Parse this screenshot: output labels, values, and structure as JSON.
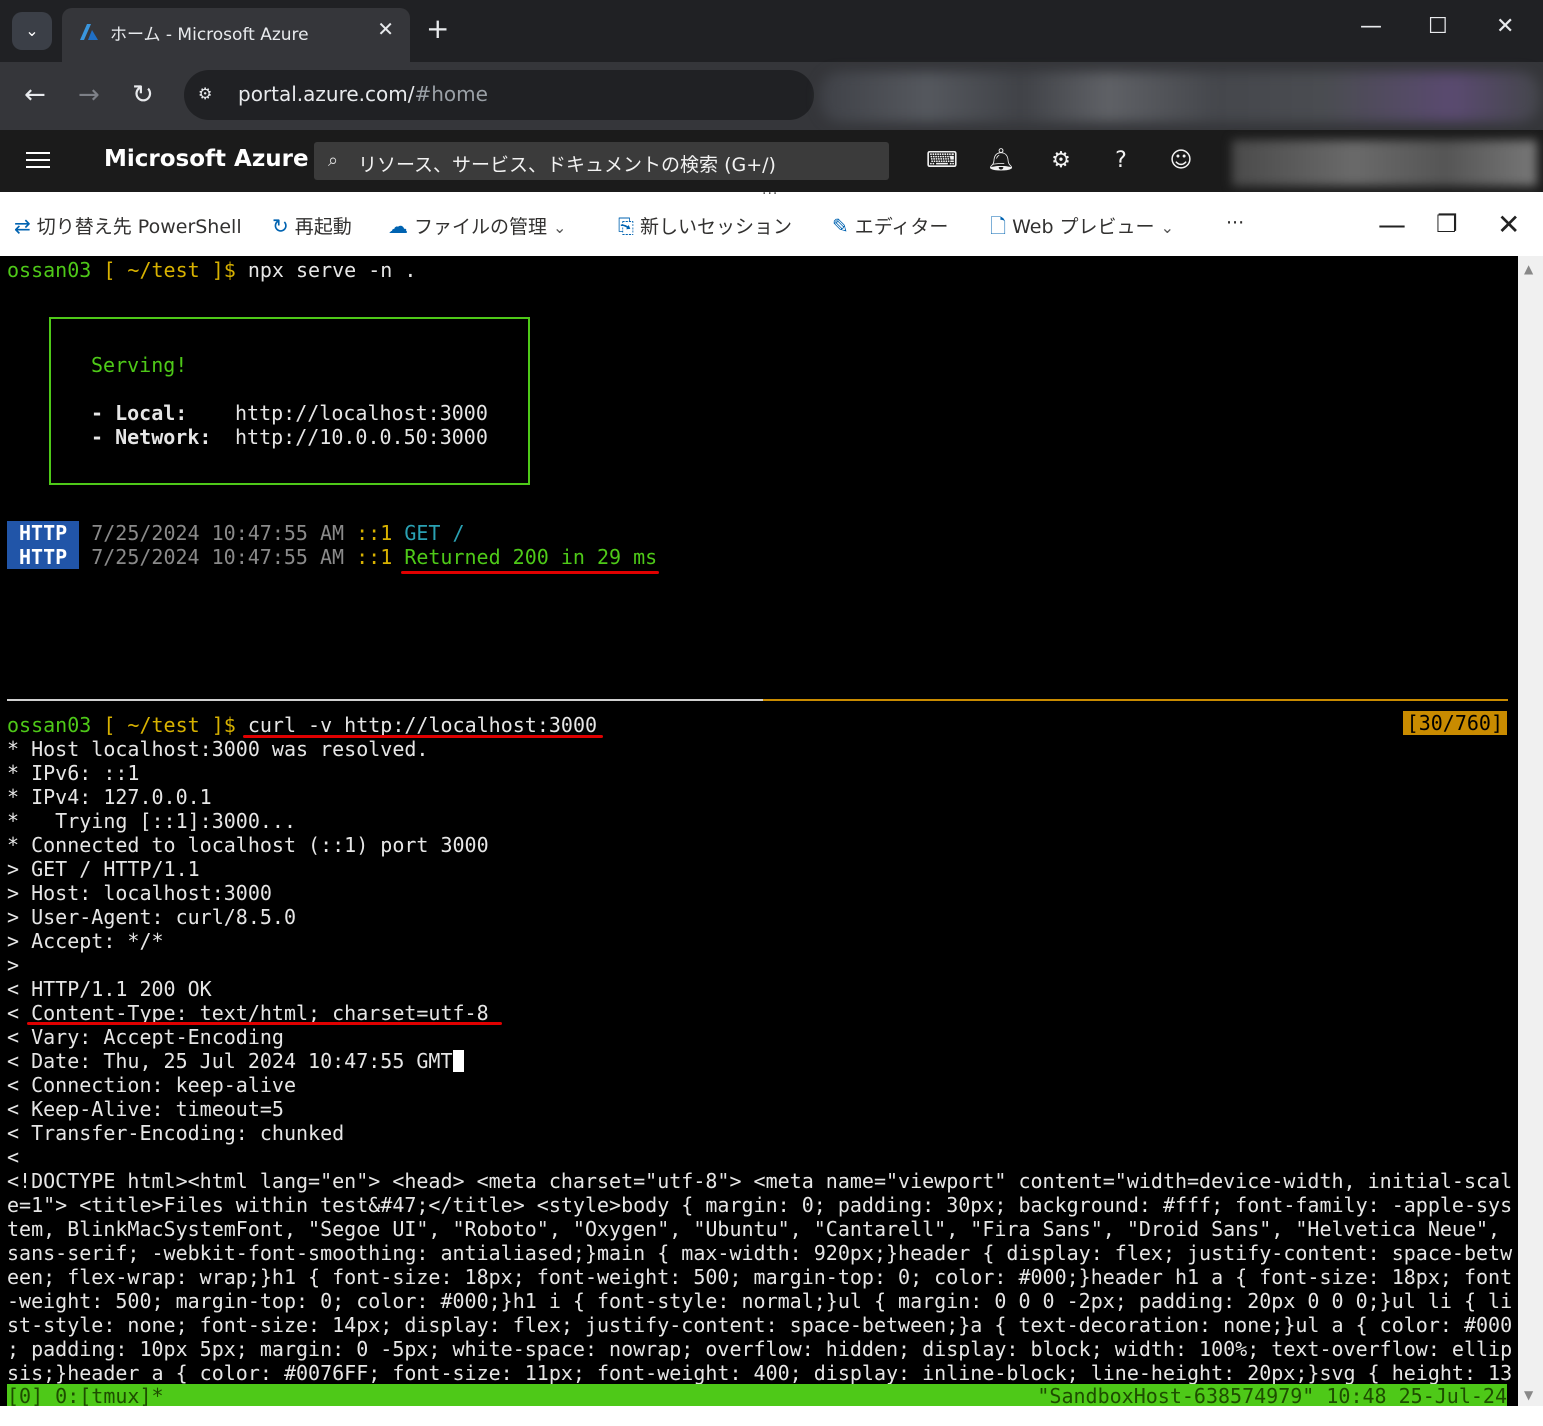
{
  "browser": {
    "tab_title": "ホーム - Microsoft Azure",
    "tab_close": "✕",
    "new_tab": "+",
    "tab_menu_icon": "chevron-down-icon",
    "window_controls": {
      "minimize": "—",
      "maximize": "☐",
      "close": "✕"
    },
    "url_host": "portal.azure.com/",
    "url_path": "#home"
  },
  "azure": {
    "brand": "Microsoft Azure",
    "search_placeholder": "リソース、サービス、ドキュメントの検索 (G+/)",
    "header_icons": [
      "cloud-shell-icon",
      "bell-icon",
      "gear-icon",
      "help-icon",
      "feedback-icon"
    ]
  },
  "cloudshell": {
    "switch_label": "切り替え先 PowerShell",
    "restart_label": "再起動",
    "files_label": "ファイルの管理",
    "new_session_label": "新しいセッション",
    "editor_label": "エディター",
    "web_preview_label": "Web プレビュー",
    "more_label": "···"
  },
  "terminal": {
    "prompt1": {
      "user": "ossan03",
      "dir": " [ ~/test ]$",
      "cmd": " npx serve -n ."
    },
    "serving": {
      "title": "Serving!",
      "local_label": "- Local:",
      "local_url": "http://localhost:3000",
      "network_label": "- Network:",
      "network_url": "http://10.0.0.50:3000"
    },
    "log": [
      {
        "tag": "HTTP",
        "time": "7/25/2024 10:47:55 AM",
        "addr": "::1",
        "msg": "GET /"
      },
      {
        "tag": "HTTP",
        "time": "7/25/2024 10:47:55 AM",
        "addr": "::1",
        "msg": "Returned 200 in 29 ms"
      }
    ],
    "prompt2": {
      "user": "ossan03",
      "dir": " [ ~/test ]$",
      "cmd": " curl -v http://localhost:3000"
    },
    "position": "[30/760]",
    "curl_lines": [
      "* Host localhost:3000 was resolved.",
      "* IPv6: ::1",
      "* IPv4: 127.0.0.1",
      "*   Trying [::1]:3000...",
      "* Connected to localhost (::1) port 3000",
      "> GET / HTTP/1.1",
      "> Host: localhost:3000",
      "> User-Agent: curl/8.5.0",
      "> Accept: */*",
      ">",
      "< HTTP/1.1 200 OK",
      "< Content-Type: text/html; charset=utf-8",
      "< Vary: Accept-Encoding",
      "< Date: Thu, 25 Jul 2024 10:47:55 GMT",
      "< Connection: keep-alive",
      "< Keep-Alive: timeout=5",
      "< Transfer-Encoding: chunked",
      "<",
      "<!DOCTYPE html><html lang=\"en\"> <head> <meta charset=\"utf-8\"> <meta name=\"viewport\" content=\"width=device-width, initial-scal",
      "e=1\"> <title>Files within test&#47;</title> <style>body { margin: 0; padding: 30px; background: #fff; font-family: -apple-sys",
      "tem, BlinkMacSystemFont, \"Segoe UI\", \"Roboto\", \"Oxygen\", \"Ubuntu\", \"Cantarell\", \"Fira Sans\", \"Droid Sans\", \"Helvetica Neue\",",
      "sans-serif; -webkit-font-smoothing: antialiased;}main { max-width: 920px;}header { display: flex; justify-content: space-betw",
      "een; flex-wrap: wrap;}h1 { font-size: 18px; font-weight: 500; margin-top: 0; color: #000;}header h1 a { font-size: 18px; font",
      "-weight: 500; margin-top: 0; color: #000;}h1 i { font-style: normal;}ul { margin: 0 0 0 -2px; padding: 20px 0 0 0;}ul li { li",
      "st-style: none; font-size: 14px; display: flex; justify-content: space-between;}a { text-decoration: none;}ul a { color: #000",
      "; padding: 10px 5px; margin: 0 -5px; white-space: nowrap; overflow: hidden; display: block; width: 100%; text-overflow: ellip",
      "sis;}header a { color: #0076FF; font-size: 11px; font-weight: 400; display: inline-block; line-height: 20px;}svg { height: 13"
    ],
    "status_left": "[0] 0:[tmux]*",
    "status_right": "\"SandboxHost-638574979\" 10:48 25-Jul-24"
  },
  "colors": {
    "prompt_green": "#4ec918",
    "accent_orange": "#c98b00",
    "http_tag_blue": "#2155a8",
    "annotation_red": "#e00000"
  }
}
